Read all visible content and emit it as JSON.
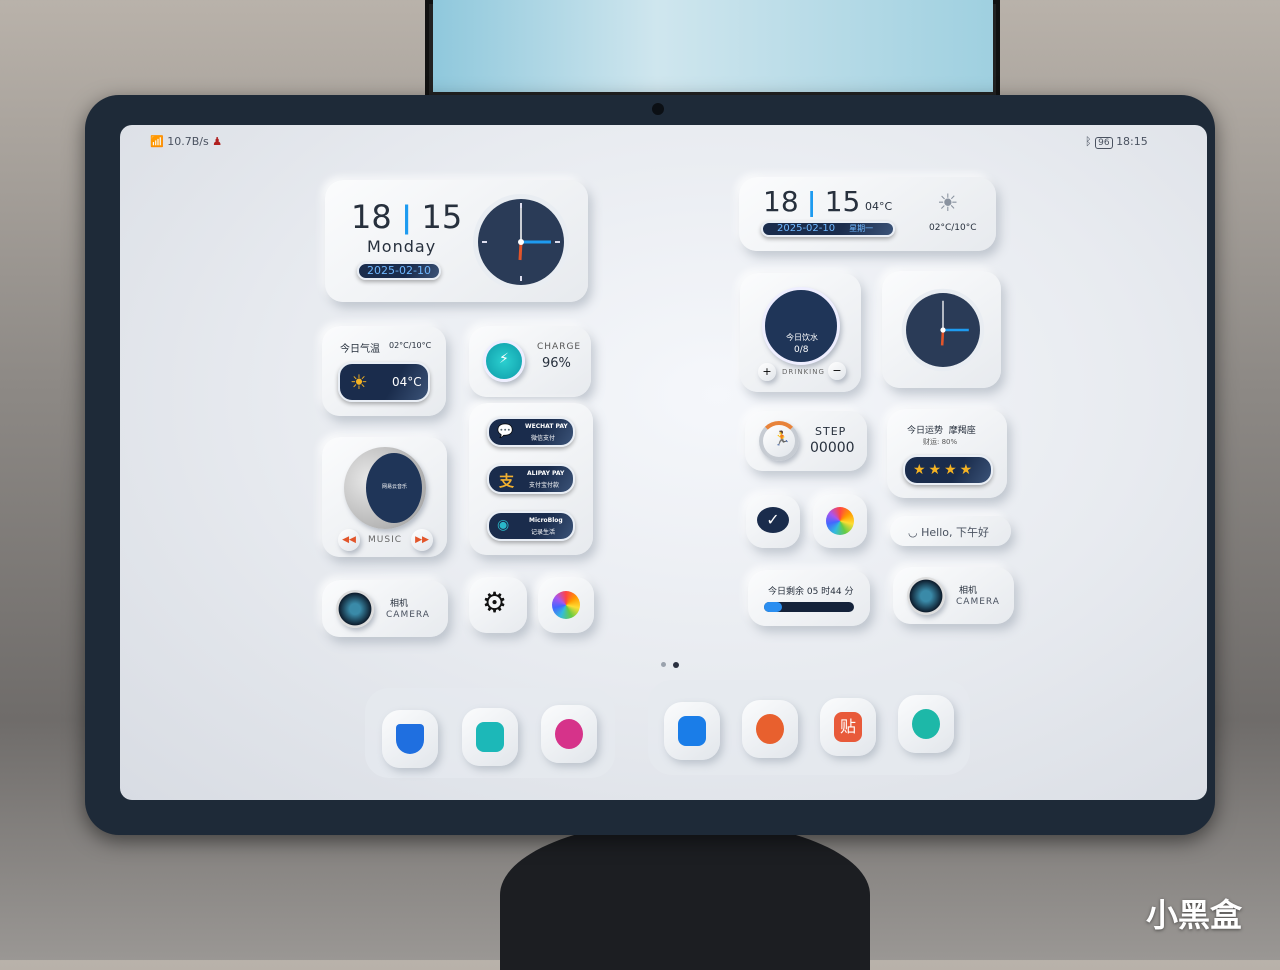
{
  "status_bar": {
    "network_speed": "10.7B/s",
    "battery": "96",
    "time": "18:15"
  },
  "clock_widget_left": {
    "hour": "18",
    "minute": "15",
    "weekday": "Monday",
    "date": "2025-02-10"
  },
  "weather_widget": {
    "title": "今日气温",
    "range": "02°C/10°C",
    "temp": "04°C"
  },
  "charge_widget": {
    "label": "CHARGE",
    "value": "96%"
  },
  "music_widget": {
    "disc_text": "网易云音乐",
    "label": "MUSIC"
  },
  "pay_widget": {
    "items": [
      {
        "en": "WECHAT PAY",
        "cn": "微信支付"
      },
      {
        "en": "ALIPAY PAY",
        "cn": "支付宝付款"
      },
      {
        "en": "MicroBlog",
        "cn": "记录生活"
      }
    ]
  },
  "camera_widget": {
    "cn": "相机",
    "en": "CAMERA"
  },
  "clock_widget_right": {
    "hour": "18",
    "minute": "15",
    "temp": "04°C",
    "date": "2025-02-10",
    "weekday": "星期一",
    "range": "02°C/10°C"
  },
  "drinking_widget": {
    "title": "今日饮水",
    "count": "0/8",
    "label": "DRINKING",
    "plus": "+",
    "minus": "−"
  },
  "step_widget": {
    "label": "STEP",
    "value": "00000"
  },
  "fortune_widget": {
    "title": "今日运势",
    "sign": "摩羯座",
    "wealth": "财运: 80%",
    "stars": 4
  },
  "hello_widget": {
    "text": "Hello, 下午好"
  },
  "timer_widget": {
    "text": "今日剩余 05 时44 分",
    "progress": 0.2
  },
  "pager": {
    "pages": 2,
    "current": 2
  },
  "dock": {
    "left": [
      "shield-icon",
      "camera-app-icon",
      "bilibili-icon"
    ],
    "right": [
      "files-icon",
      "settings-flower-icon",
      "tie-app-icon",
      "swirl-app-icon"
    ]
  },
  "watermark": "小黑盒",
  "colors": {
    "accent_blue": "#1e9bf0",
    "pill_navy": "#1a2c4c",
    "charge_teal": "#17b8c0",
    "star": "#f5b323"
  }
}
